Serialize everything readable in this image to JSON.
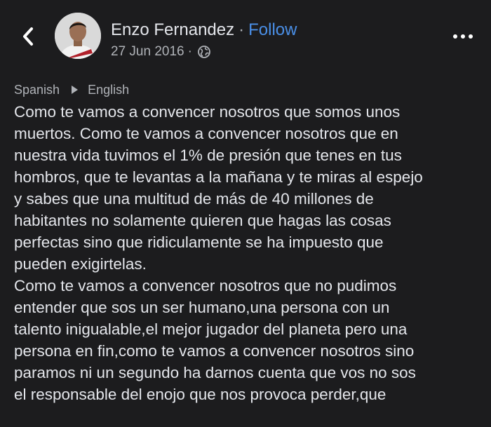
{
  "post": {
    "author_name": "Enzo Fernandez",
    "separator": "·",
    "follow_label": "Follow",
    "date": "27 Jun 2016",
    "date_separator": "·",
    "privacy_icon": "globe-icon"
  },
  "translation": {
    "source_language": "Spanish",
    "target_language": "English"
  },
  "icons": {
    "back": "chevron-left-icon",
    "more": "more-horizontal-icon"
  },
  "colors": {
    "background": "#1c1c1e",
    "text": "#e4e6eb",
    "secondary_text": "#b0b3b8",
    "link_blue": "#4a8fe7"
  },
  "body_text": "Como te vamos a convencer nosotros que somos unos\nmuertos. Como te vamos a convencer nosotros que en\nnuestra vida tuvimos el 1% de presión que tenes en tus\nhombros, que te levantas a la mañana y te miras al espejo\ny sabes que una multitud de más de 40 millones de\nhabitantes no solamente quieren que hagas las cosas\nperfectas sino que ridiculamente se ha impuesto que\npueden exigirtelas.\nComo te vamos a convencer nosotros que no pudimos\nentender que sos un ser humano,una persona con un\ntalento inigualable,el mejor jugador del planeta pero una\npersona en fin,como te vamos a convencer nosotros sino\nparamos ni un segundo ha darnos cuenta que vos no sos\nel responsable del enojo que nos provoca perder,que"
}
